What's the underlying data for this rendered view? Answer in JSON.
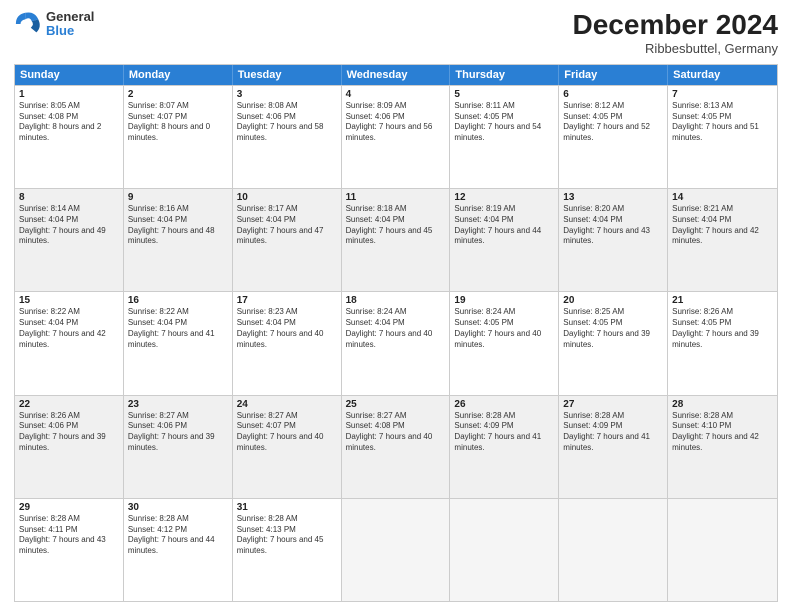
{
  "header": {
    "logo_general": "General",
    "logo_blue": "Blue",
    "month_title": "December 2024",
    "subtitle": "Ribbesbuttel, Germany"
  },
  "days": [
    "Sunday",
    "Monday",
    "Tuesday",
    "Wednesday",
    "Thursday",
    "Friday",
    "Saturday"
  ],
  "weeks": [
    [
      {
        "num": "1",
        "sunrise": "Sunrise: 8:05 AM",
        "sunset": "Sunset: 4:08 PM",
        "daylight": "Daylight: 8 hours and 2 minutes.",
        "shaded": false
      },
      {
        "num": "2",
        "sunrise": "Sunrise: 8:07 AM",
        "sunset": "Sunset: 4:07 PM",
        "daylight": "Daylight: 8 hours and 0 minutes.",
        "shaded": false
      },
      {
        "num": "3",
        "sunrise": "Sunrise: 8:08 AM",
        "sunset": "Sunset: 4:06 PM",
        "daylight": "Daylight: 7 hours and 58 minutes.",
        "shaded": false
      },
      {
        "num": "4",
        "sunrise": "Sunrise: 8:09 AM",
        "sunset": "Sunset: 4:06 PM",
        "daylight": "Daylight: 7 hours and 56 minutes.",
        "shaded": false
      },
      {
        "num": "5",
        "sunrise": "Sunrise: 8:11 AM",
        "sunset": "Sunset: 4:05 PM",
        "daylight": "Daylight: 7 hours and 54 minutes.",
        "shaded": false
      },
      {
        "num": "6",
        "sunrise": "Sunrise: 8:12 AM",
        "sunset": "Sunset: 4:05 PM",
        "daylight": "Daylight: 7 hours and 52 minutes.",
        "shaded": false
      },
      {
        "num": "7",
        "sunrise": "Sunrise: 8:13 AM",
        "sunset": "Sunset: 4:05 PM",
        "daylight": "Daylight: 7 hours and 51 minutes.",
        "shaded": false
      }
    ],
    [
      {
        "num": "8",
        "sunrise": "Sunrise: 8:14 AM",
        "sunset": "Sunset: 4:04 PM",
        "daylight": "Daylight: 7 hours and 49 minutes.",
        "shaded": true
      },
      {
        "num": "9",
        "sunrise": "Sunrise: 8:16 AM",
        "sunset": "Sunset: 4:04 PM",
        "daylight": "Daylight: 7 hours and 48 minutes.",
        "shaded": true
      },
      {
        "num": "10",
        "sunrise": "Sunrise: 8:17 AM",
        "sunset": "Sunset: 4:04 PM",
        "daylight": "Daylight: 7 hours and 47 minutes.",
        "shaded": true
      },
      {
        "num": "11",
        "sunrise": "Sunrise: 8:18 AM",
        "sunset": "Sunset: 4:04 PM",
        "daylight": "Daylight: 7 hours and 45 minutes.",
        "shaded": true
      },
      {
        "num": "12",
        "sunrise": "Sunrise: 8:19 AM",
        "sunset": "Sunset: 4:04 PM",
        "daylight": "Daylight: 7 hours and 44 minutes.",
        "shaded": true
      },
      {
        "num": "13",
        "sunrise": "Sunrise: 8:20 AM",
        "sunset": "Sunset: 4:04 PM",
        "daylight": "Daylight: 7 hours and 43 minutes.",
        "shaded": true
      },
      {
        "num": "14",
        "sunrise": "Sunrise: 8:21 AM",
        "sunset": "Sunset: 4:04 PM",
        "daylight": "Daylight: 7 hours and 42 minutes.",
        "shaded": true
      }
    ],
    [
      {
        "num": "15",
        "sunrise": "Sunrise: 8:22 AM",
        "sunset": "Sunset: 4:04 PM",
        "daylight": "Daylight: 7 hours and 42 minutes.",
        "shaded": false
      },
      {
        "num": "16",
        "sunrise": "Sunrise: 8:22 AM",
        "sunset": "Sunset: 4:04 PM",
        "daylight": "Daylight: 7 hours and 41 minutes.",
        "shaded": false
      },
      {
        "num": "17",
        "sunrise": "Sunrise: 8:23 AM",
        "sunset": "Sunset: 4:04 PM",
        "daylight": "Daylight: 7 hours and 40 minutes.",
        "shaded": false
      },
      {
        "num": "18",
        "sunrise": "Sunrise: 8:24 AM",
        "sunset": "Sunset: 4:04 PM",
        "daylight": "Daylight: 7 hours and 40 minutes.",
        "shaded": false
      },
      {
        "num": "19",
        "sunrise": "Sunrise: 8:24 AM",
        "sunset": "Sunset: 4:05 PM",
        "daylight": "Daylight: 7 hours and 40 minutes.",
        "shaded": false
      },
      {
        "num": "20",
        "sunrise": "Sunrise: 8:25 AM",
        "sunset": "Sunset: 4:05 PM",
        "daylight": "Daylight: 7 hours and 39 minutes.",
        "shaded": false
      },
      {
        "num": "21",
        "sunrise": "Sunrise: 8:26 AM",
        "sunset": "Sunset: 4:05 PM",
        "daylight": "Daylight: 7 hours and 39 minutes.",
        "shaded": false
      }
    ],
    [
      {
        "num": "22",
        "sunrise": "Sunrise: 8:26 AM",
        "sunset": "Sunset: 4:06 PM",
        "daylight": "Daylight: 7 hours and 39 minutes.",
        "shaded": true
      },
      {
        "num": "23",
        "sunrise": "Sunrise: 8:27 AM",
        "sunset": "Sunset: 4:06 PM",
        "daylight": "Daylight: 7 hours and 39 minutes.",
        "shaded": true
      },
      {
        "num": "24",
        "sunrise": "Sunrise: 8:27 AM",
        "sunset": "Sunset: 4:07 PM",
        "daylight": "Daylight: 7 hours and 40 minutes.",
        "shaded": true
      },
      {
        "num": "25",
        "sunrise": "Sunrise: 8:27 AM",
        "sunset": "Sunset: 4:08 PM",
        "daylight": "Daylight: 7 hours and 40 minutes.",
        "shaded": true
      },
      {
        "num": "26",
        "sunrise": "Sunrise: 8:28 AM",
        "sunset": "Sunset: 4:09 PM",
        "daylight": "Daylight: 7 hours and 41 minutes.",
        "shaded": true
      },
      {
        "num": "27",
        "sunrise": "Sunrise: 8:28 AM",
        "sunset": "Sunset: 4:09 PM",
        "daylight": "Daylight: 7 hours and 41 minutes.",
        "shaded": true
      },
      {
        "num": "28",
        "sunrise": "Sunrise: 8:28 AM",
        "sunset": "Sunset: 4:10 PM",
        "daylight": "Daylight: 7 hours and 42 minutes.",
        "shaded": true
      }
    ],
    [
      {
        "num": "29",
        "sunrise": "Sunrise: 8:28 AM",
        "sunset": "Sunset: 4:11 PM",
        "daylight": "Daylight: 7 hours and 43 minutes.",
        "shaded": false
      },
      {
        "num": "30",
        "sunrise": "Sunrise: 8:28 AM",
        "sunset": "Sunset: 4:12 PM",
        "daylight": "Daylight: 7 hours and 44 minutes.",
        "shaded": false
      },
      {
        "num": "31",
        "sunrise": "Sunrise: 8:28 AM",
        "sunset": "Sunset: 4:13 PM",
        "daylight": "Daylight: 7 hours and 45 minutes.",
        "shaded": false
      },
      null,
      null,
      null,
      null
    ]
  ]
}
